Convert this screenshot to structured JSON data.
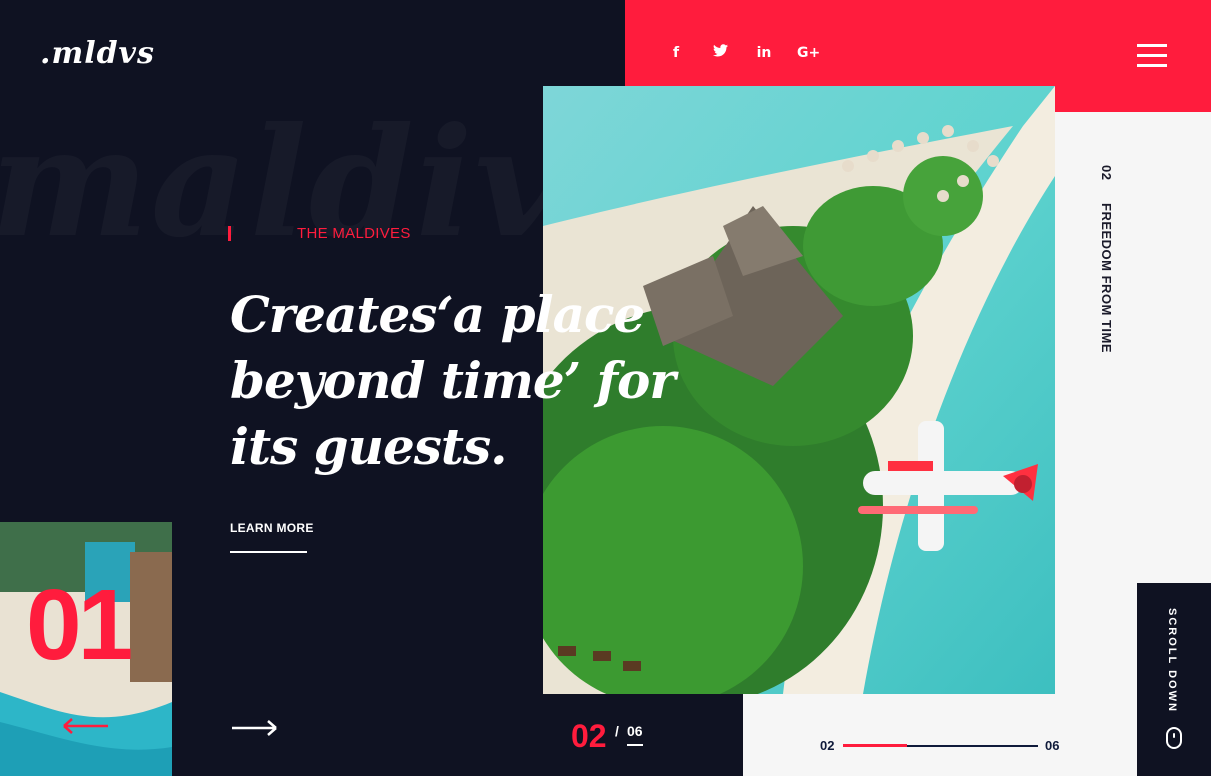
{
  "brand": {
    "logo": ".mldvs",
    "watermark": "maldives"
  },
  "header": {
    "social": [
      {
        "icon": "facebook-icon",
        "glyph": "f"
      },
      {
        "icon": "twitter-icon",
        "glyph": "🐦"
      },
      {
        "icon": "linkedin-icon",
        "glyph": "in"
      },
      {
        "icon": "google-plus-icon",
        "glyph": "G+"
      }
    ],
    "menu_icon": "hamburger-menu-icon"
  },
  "hero": {
    "eyebrow": "THE MALDIVES",
    "headline": [
      "Creates‘a place",
      "beyond time’ for",
      "its guests."
    ],
    "cta": "LEARN MORE"
  },
  "slides": {
    "prev_number": "01",
    "current": "02",
    "separator": "/",
    "total": "06"
  },
  "side_label": {
    "number": "02",
    "text": "FREEDOM FROM TIME"
  },
  "progress": {
    "start": "02",
    "end": "06",
    "fraction": 0.33
  },
  "scroll": {
    "label": "SCROLL DOWN"
  },
  "colors": {
    "accent": "#ff1c3d",
    "dark": "#0f1222",
    "light": "#f6f6f6"
  }
}
